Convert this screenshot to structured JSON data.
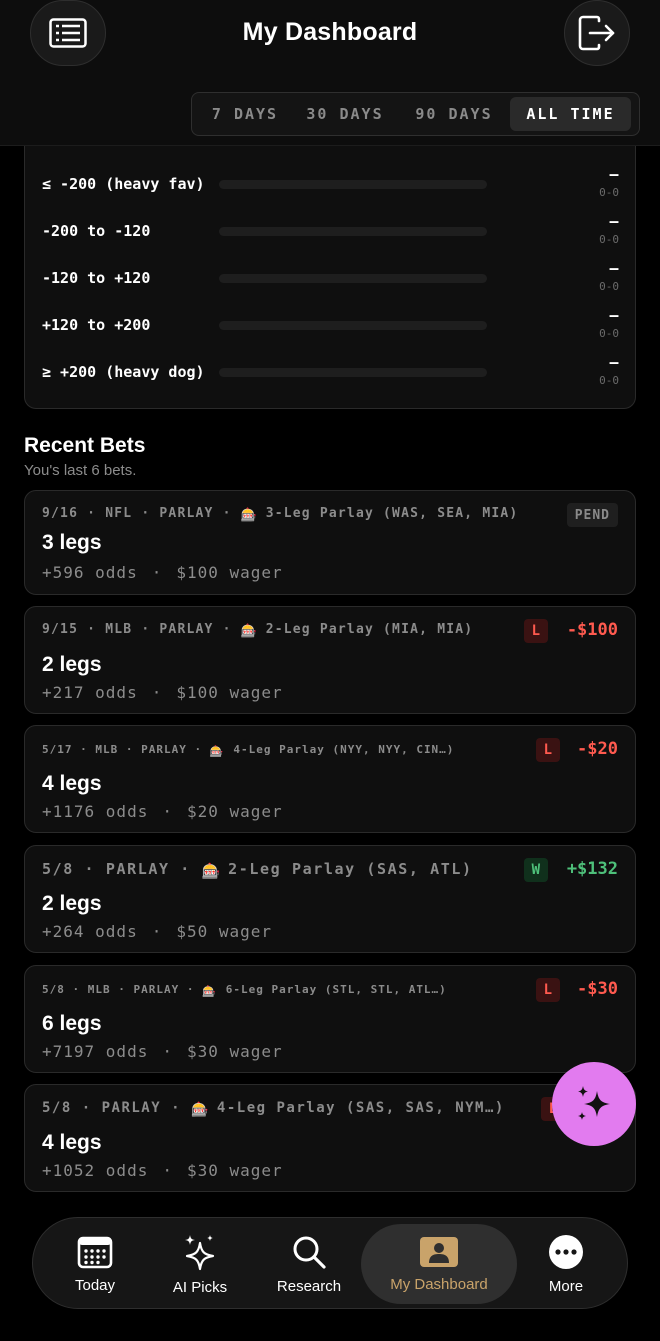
{
  "header": {
    "title": "My Dashboard",
    "left_icon": "list-icon",
    "right_icon": "logout-icon"
  },
  "range_tabs": [
    "7 DAYS",
    "30 DAYS",
    "90 DAYS",
    "ALL TIME"
  ],
  "range_active": "ALL TIME",
  "odds_buckets": [
    {
      "label": "≤ -200 (heavy fav)",
      "value": "–",
      "record": "0-0"
    },
    {
      "label": "-200 to -120",
      "value": "–",
      "record": "0-0"
    },
    {
      "label": "-120 to +120",
      "value": "–",
      "record": "0-0"
    },
    {
      "label": "+120 to +200",
      "value": "–",
      "record": "0-0"
    },
    {
      "label": "≥ +200 (heavy dog)",
      "value": "–",
      "record": "0-0"
    }
  ],
  "recent": {
    "title": "Recent Bets",
    "subtitle": "You's last 6 bets."
  },
  "bets": [
    {
      "date": "9/16",
      "league": "NFL",
      "type": "PARLAY",
      "desc": "3-Leg Parlay (WAS, SEA, MIA)",
      "title": "3 legs",
      "odds": "+596 odds",
      "wager": "$100 wager",
      "badge": "PEND",
      "amount": ""
    },
    {
      "date": "9/15",
      "league": "MLB",
      "type": "PARLAY",
      "desc": "2-Leg Parlay (MIA, MIA)",
      "title": "2 legs",
      "odds": "+217 odds",
      "wager": "$100 wager",
      "badge": "L",
      "amount": "-$100"
    },
    {
      "date": "5/17",
      "league": "MLB",
      "type": "PARLAY",
      "desc": "4-Leg Parlay (NYY, NYY, CIN…)",
      "title": "4 legs",
      "odds": "+1176 odds",
      "wager": "$20 wager",
      "badge": "L",
      "amount": "-$20"
    },
    {
      "date": "5/8",
      "league": "",
      "type": "PARLAY",
      "desc": "2-Leg Parlay (SAS, ATL)",
      "title": "2 legs",
      "odds": "+264 odds",
      "wager": "$50 wager",
      "badge": "W",
      "amount": "+$132"
    },
    {
      "date": "5/8",
      "league": "MLB",
      "type": "PARLAY",
      "desc": "6-Leg Parlay (STL, STL, ATL…)",
      "title": "6 legs",
      "odds": "+7197 odds",
      "wager": "$30 wager",
      "badge": "L",
      "amount": "-$30"
    },
    {
      "date": "5/8",
      "league": "",
      "type": "PARLAY",
      "desc": "4-Leg Parlay (SAS, SAS, NYM…)",
      "title": "4 legs",
      "odds": "+1052 odds",
      "wager": "$30 wager",
      "badge": "L",
      "amount": ""
    }
  ],
  "fab_icon": "sparkle-icon",
  "nav": [
    {
      "label": "Today",
      "icon": "calendar-icon"
    },
    {
      "label": "AI Picks",
      "icon": "sparkles-icon"
    },
    {
      "label": "Research",
      "icon": "search-icon"
    },
    {
      "label": "My Dashboard",
      "icon": "person-card-icon"
    },
    {
      "label": "More",
      "icon": "more-icon"
    }
  ],
  "colors": {
    "loss": "#ff5a4f",
    "win": "#4ec07a",
    "accent_nav": "#c9a36a",
    "fab": "#e27bef"
  }
}
